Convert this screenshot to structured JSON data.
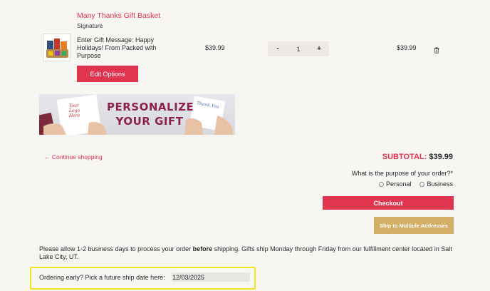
{
  "cart_item": {
    "name": "Many Thanks Gift Basket",
    "variant": "Signature",
    "gift_message": "Enter Gift Message: Happy Holidays! From Packed with Purpose",
    "price": "$39.99",
    "quantity": "1",
    "qty_minus": "-",
    "qty_plus": "+",
    "line_total": "$39.99",
    "edit_label": "Edit Options"
  },
  "banner": {
    "line1": "PERSONALIZE",
    "line2": "YOUR GIFT",
    "card_left_text": "Your Logo Here",
    "card_right_text": "Thank You"
  },
  "continue_label": "Continue shopping",
  "subtotal": {
    "label": "SUBTOTAL:",
    "value": "$39.99"
  },
  "purpose": {
    "question": "What is the purpose of your order?*",
    "options": [
      "Personal",
      "Business"
    ]
  },
  "checkout_label": "Checkout",
  "multi_address_label": "Ship to Multiple Addresses",
  "notice": {
    "before": "Please allow 1-2 business days to process your order ",
    "bold": "before",
    "after": " shipping. Gifts ship Monday through Friday from our fulfillment center located in Salt Lake City, UT."
  },
  "ship_date": {
    "label": "Ordering early? Pick a future ship date here:",
    "value": "12/03/2025"
  },
  "colors": {
    "accent": "#e0344f",
    "gold": "#d3b066",
    "highlight": "#f2e520",
    "banner_text": "#8f2249"
  }
}
